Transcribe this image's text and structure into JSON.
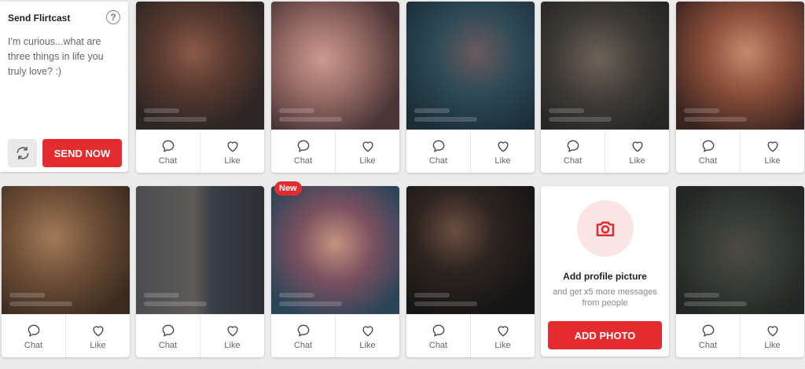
{
  "flirtcast": {
    "title": "Send Flirtcast",
    "help_icon": "?",
    "message": "I'm curious...what are three things in life you truly love? :)",
    "send_label": "SEND NOW"
  },
  "actions": {
    "chat": "Chat",
    "like": "Like"
  },
  "badge_new": "New",
  "add_photo": {
    "title": "Add profile picture",
    "subtitle": "and get x5 more messages from people",
    "button": "ADD PHOTO"
  },
  "colors": {
    "accent": "#e42b2f",
    "accent_light": "#fbe4e4"
  }
}
